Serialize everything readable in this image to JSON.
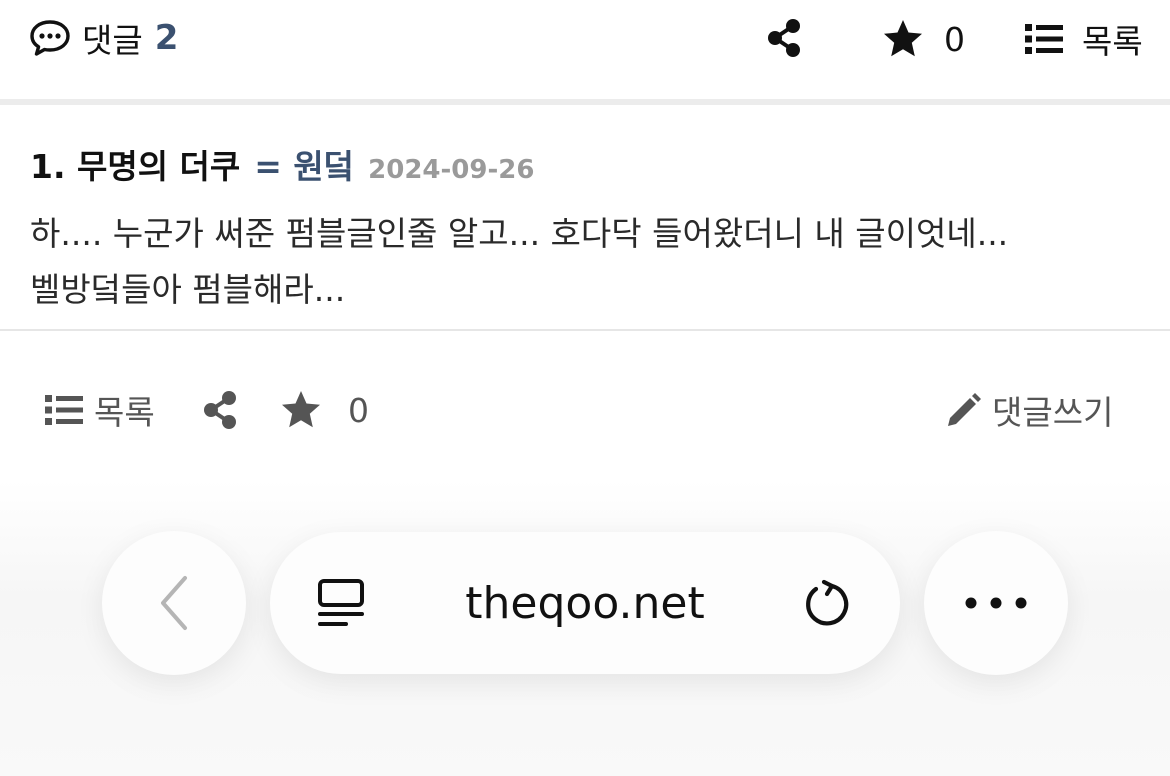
{
  "topbar": {
    "comment_label": "댓글",
    "comment_count": "2",
    "favorite_count": "0",
    "list_label": "목록"
  },
  "comment": {
    "name": "1. 무명의 더쿠",
    "tag": "= 원덬",
    "date": "2024-09-26",
    "line1": "하.... 누군가 써준 펌블글인줄 알고... 호다닥 들어왔더니 내 글이엇네...",
    "line2": "벨방덬들아 펌블해라..."
  },
  "actions": {
    "list_label": "목록",
    "favorite_count": "0",
    "write_label": "댓글쓰기"
  },
  "browser": {
    "url": "theqoo.net"
  },
  "icons": {
    "comment": "speech-bubble-icon",
    "share": "share-icon",
    "star": "star-icon",
    "list": "list-icon",
    "pencil": "pencil-icon",
    "back": "chevron-left-icon",
    "reader": "reader-icon",
    "reload": "reload-icon",
    "more": "more-dots-icon"
  },
  "colors": {
    "accent": "#3b5170",
    "date": "#9a9a9a",
    "action": "#555555"
  }
}
